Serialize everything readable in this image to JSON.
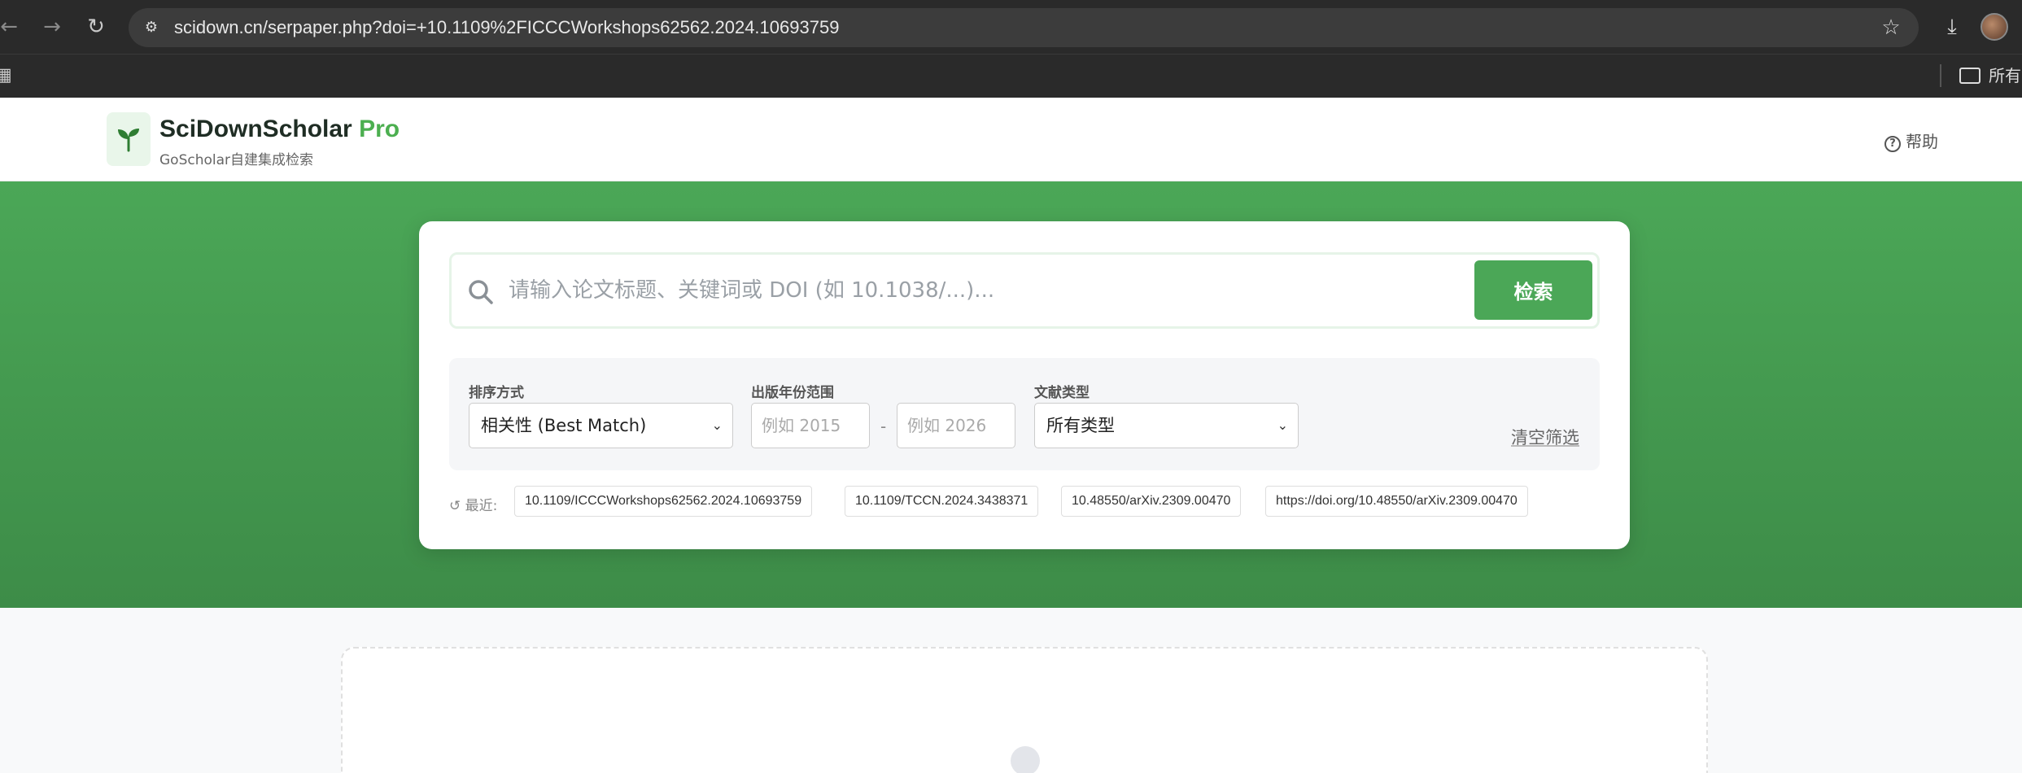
{
  "browser": {
    "url": "scidown.cn/serpaper.php?doi=+10.1109%2FICCCWorkshops62562.2024.10693759",
    "bookmark_folder": "所有书签",
    "icons": [
      "back-icon",
      "forward-icon",
      "reload-icon",
      "site-info-icon",
      "star-icon",
      "download-icon",
      "apps-icon",
      "folder-icon"
    ]
  },
  "header": {
    "brand": "SciDownScholar",
    "brand_suffix": "Pro",
    "subtitle": "GoScholar自建集成检索",
    "help": "帮助"
  },
  "search": {
    "placeholder": "请输入论文标题、关键词或 DOI (如 10.1038/...)...",
    "button": "检索"
  },
  "filters": {
    "sort_label": "排序方式",
    "sort_value": "相关性 (Best Match)",
    "year_label": "出版年份范围",
    "year_from_placeholder": "例如 2015",
    "year_to_placeholder": "例如 2026",
    "year_sep": "-",
    "type_label": "文献类型",
    "type_value": "所有类型",
    "clear": "清空筛选"
  },
  "recent": {
    "label": "最近:",
    "items": [
      "10.1109/ICCCWorkshops62562.2024.10693759",
      "10.1109/TCCN.2024.3438371",
      "10.48550/arXiv.2309.00470",
      "https://doi.org/10.48550/arXiv.2309.00470"
    ]
  },
  "colors": {
    "accent": "#4ba757",
    "hero_top": "#4ba757",
    "hero_bottom": "#3d8c48"
  }
}
